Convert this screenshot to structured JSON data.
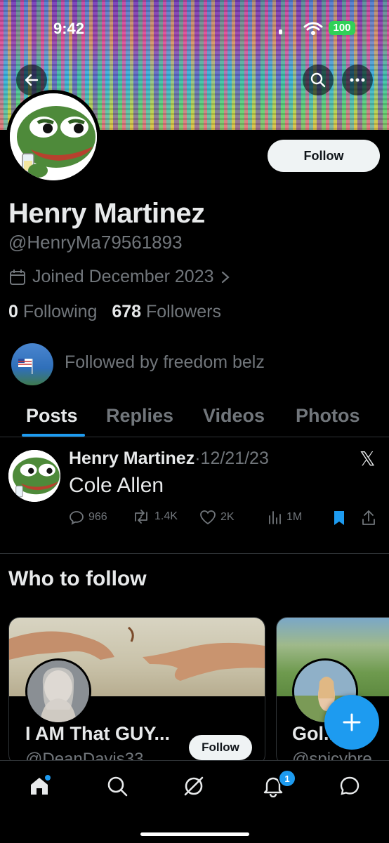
{
  "status_bar": {
    "time": "9:42",
    "battery": "100"
  },
  "profile": {
    "follow_label": "Follow",
    "name": "Henry Martinez",
    "handle": "@HenryMa79561893",
    "joined": "Joined December 2023",
    "following_count": "0",
    "following_label": "Following",
    "followers_count": "678",
    "followers_label": "Followers",
    "followed_by": "Followed by freedom belz"
  },
  "tabs": [
    {
      "label": "Posts",
      "active": true
    },
    {
      "label": "Replies",
      "active": false
    },
    {
      "label": "Videos",
      "active": false
    },
    {
      "label": "Photos",
      "active": false
    }
  ],
  "post": {
    "author": "Henry Martinez",
    "date": "12/21/23",
    "text": "Cole Allen",
    "replies": "966",
    "reposts": "1.4K",
    "likes": "2K",
    "views": "1M"
  },
  "who_to_follow": {
    "title": "Who to follow",
    "cards": [
      {
        "name": "I AM That GUY...",
        "handle": "@DeanDavis33",
        "follow_label": "Follow"
      },
      {
        "name": "Gol...",
        "handle": "@spicybre..."
      }
    ]
  },
  "nav": {
    "notifications_badge": "1"
  },
  "colors": {
    "accent": "#1d9bf0",
    "background": "#000000",
    "muted": "#71767b"
  },
  "icons": [
    "back-arrow-icon",
    "search-icon",
    "more-icon",
    "calendar-icon",
    "chevron-right-icon",
    "x-logo-icon",
    "reply-icon",
    "repost-icon",
    "like-icon",
    "views-icon",
    "bookmark-icon",
    "share-icon",
    "plus-icon",
    "home-icon",
    "explore-icon",
    "grok-icon",
    "bell-icon",
    "messages-icon"
  ]
}
